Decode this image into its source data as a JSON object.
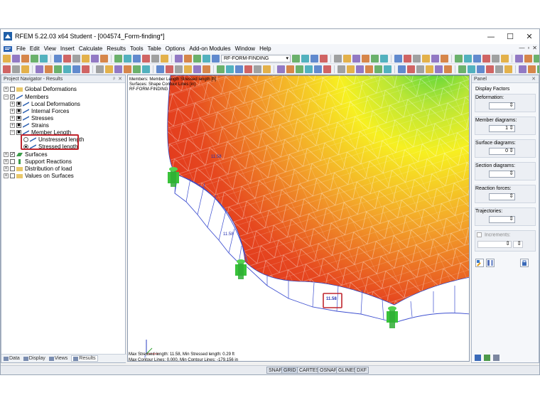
{
  "window": {
    "title": "RFEM 5.22.03 x64 Student - [004574_Form-finding*]",
    "controls": {
      "minimize": "—",
      "maximize": "☐",
      "close": "✕"
    }
  },
  "menu": [
    "File",
    "Edit",
    "View",
    "Insert",
    "Calculate",
    "Results",
    "Tools",
    "Table",
    "Options",
    "Add-on Modules",
    "Window",
    "Help"
  ],
  "menu_right": [
    "—",
    "▫",
    "✕"
  ],
  "toolbar": {
    "combo_value": "RF-FORM-FINDING"
  },
  "navigator": {
    "title": "Project Navigator - Results",
    "items": [
      {
        "label": "Global Deformations"
      },
      {
        "label": "Members"
      },
      {
        "label": "Local Deformations"
      },
      {
        "label": "Internal Forces"
      },
      {
        "label": "Stresses"
      },
      {
        "label": "Strains"
      },
      {
        "label": "Member Length"
      },
      {
        "label": "Unstressed length"
      },
      {
        "label": "Stressed length"
      },
      {
        "label": "Surfaces"
      },
      {
        "label": "Support Reactions"
      },
      {
        "label": "Distribution of load"
      },
      {
        "label": "Values on Surfaces"
      }
    ],
    "tabs": [
      {
        "label": "Data"
      },
      {
        "label": "Display"
      },
      {
        "label": "Views"
      },
      {
        "label": "Results"
      }
    ]
  },
  "viewport": {
    "info_lines": [
      "Members: Member Length Stressed length [ft]",
      "Surfaces: Shape Contour Lines [in]",
      "RF-FORM-FINDING"
    ],
    "member_labels": [
      "11.58",
      "11.58",
      "11.58"
    ],
    "axis_label": "Z",
    "footer_lines": [
      "Max Stressed length: 11.58, Min Stressed length: 0.29 ft",
      "Max Contour Lines: 0.000, Min Contour Lines: -179.156 in"
    ]
  },
  "statusbar": {
    "buttons": [
      "SNAP",
      "GRID",
      "CARTES",
      "OSNAP",
      "GLINES",
      "DXF"
    ]
  },
  "panel": {
    "title": "Panel",
    "section_title": "Display Factors",
    "groups": [
      {
        "label": "Deformation:",
        "value": ""
      },
      {
        "label": "Member diagrams:",
        "value": "1"
      },
      {
        "label": "Surface diagrams:",
        "value": "0"
      },
      {
        "label": "Section diagrams:",
        "value": ""
      },
      {
        "label": "Reaction forces:",
        "value": ""
      },
      {
        "label": "Trajectories:",
        "value": ""
      }
    ],
    "increments_label": "Increments:"
  },
  "colors": {
    "result_red": "#d8141c",
    "result_yellow": "#f7f021",
    "result_green": "#3fd13a",
    "support_green": "#39c23a",
    "highlight_red": "#c0262e",
    "member_blue": "#3d4fd0"
  }
}
